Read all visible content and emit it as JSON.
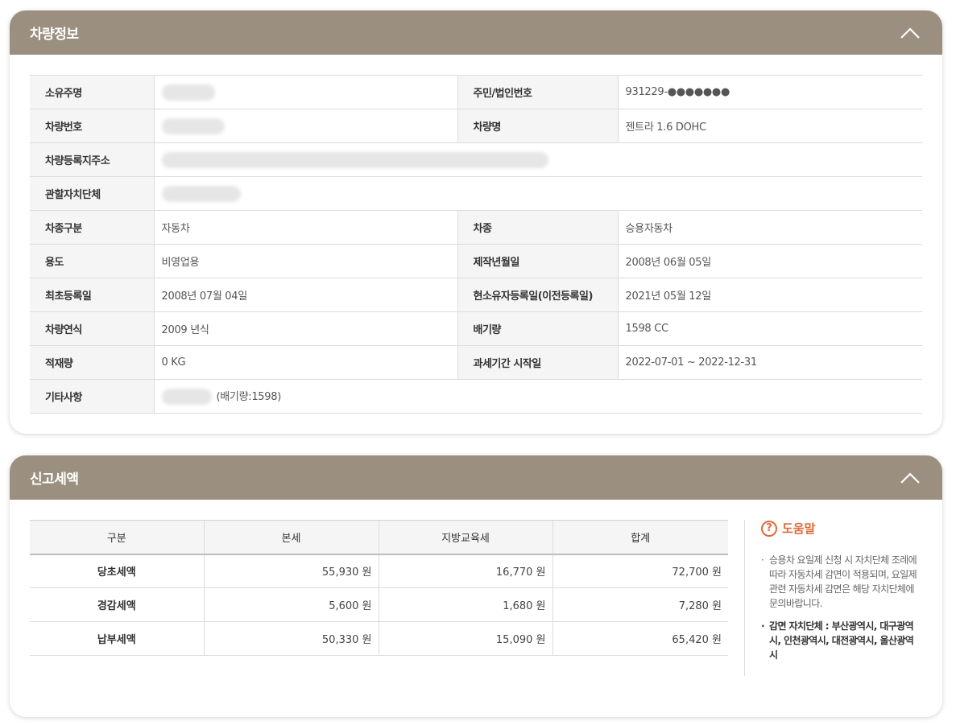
{
  "vehicle_panel": {
    "title": "차량정보",
    "rows": [
      {
        "l1": "소유주명",
        "v1": "",
        "l2": "주민/법인번호",
        "v2": "931229-●●●●●●●"
      },
      {
        "l1": "차량번호",
        "v1": "",
        "l2": "차량명",
        "v2": "젠트라 1.6 DOHC"
      },
      {
        "l1": "차량등록지주소",
        "v1": ""
      },
      {
        "l1": "관할자치단체",
        "v1": ""
      },
      {
        "l1": "차종구분",
        "v1": "자동차",
        "l2": "차종",
        "v2": "승용자동차"
      },
      {
        "l1": "용도",
        "v1": "비영업용",
        "l2": "제작년월일",
        "v2": "2008년 06월 05일"
      },
      {
        "l1": "최초등록일",
        "v1": "2008년 07월 04일",
        "l2": "현소유자등록일(이전등록일)",
        "v2": "2021년 05월 12일"
      },
      {
        "l1": "차량연식",
        "v1": "2009 년식",
        "l2": "배기량",
        "v2": "1598 CC"
      },
      {
        "l1": "적재량",
        "v1": "0 KG",
        "l2": "과세기간 시작일",
        "v2": "2022-07-01 ~ 2022-12-31"
      },
      {
        "l1": "기타사항",
        "v1": "(배기량:1598)"
      }
    ]
  },
  "tax_panel": {
    "title": "신고세액",
    "headers": [
      "구분",
      "본세",
      "지방교육세",
      "합계"
    ],
    "rows": [
      {
        "label": "당초세액",
        "base": "55,930 원",
        "edu": "16,770 원",
        "total": "72,700 원"
      },
      {
        "label": "경감세액",
        "base": "5,600 원",
        "edu": "1,680 원",
        "total": "7,280 원"
      },
      {
        "label": "납부세액",
        "base": "50,330 원",
        "edu": "15,090 원",
        "total": "65,420 원"
      }
    ],
    "help": {
      "icon": "?",
      "title": "도움말",
      "p1": "승용차 요일제 신청 시 자치단체 조례에 따라 자동차세 감면이 적용되며, 요일제 관련 자동차세 감면은 해당 자치단체에 문의바랍니다.",
      "p2": "감면 자치단체 : 부산광역시, 대구광역시, 인천광역시, 대전광역시, 울산광역시"
    }
  },
  "colors": {
    "header_bg": "#9b9080",
    "accent": "#e06a3b"
  }
}
